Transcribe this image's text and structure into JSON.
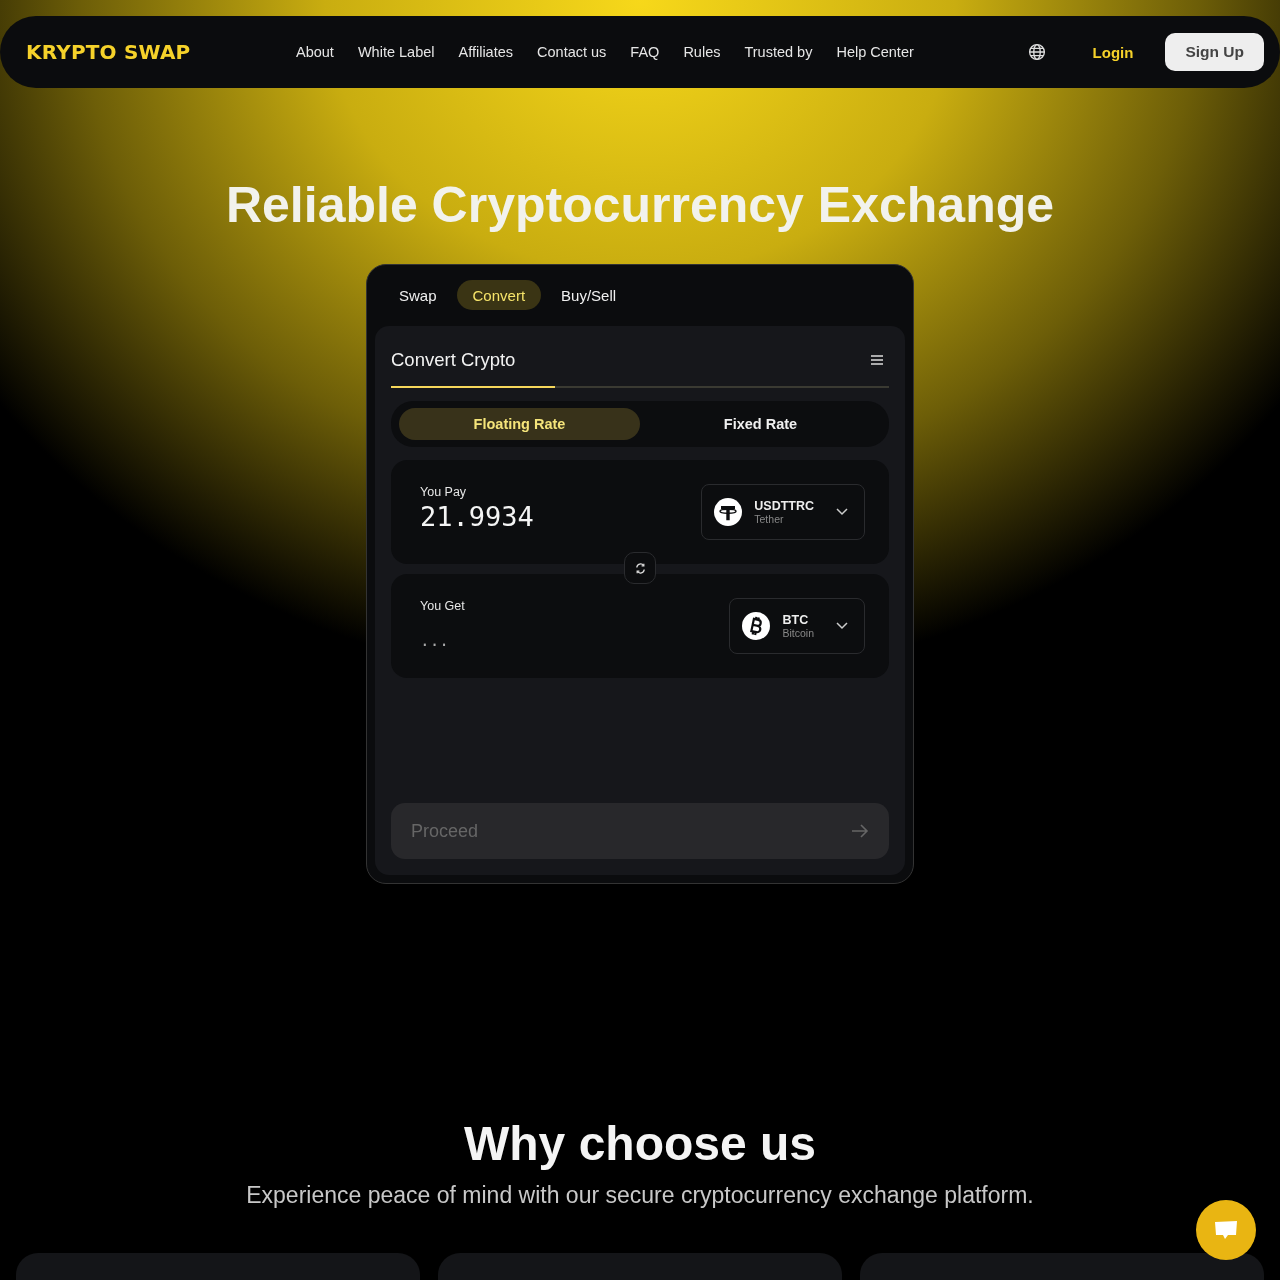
{
  "logo": "KRYPTO SWAP",
  "nav": [
    "About",
    "White Label",
    "Affiliates",
    "Contact us",
    "FAQ",
    "Rules",
    "Trusted by",
    "Help Center"
  ],
  "login": "Login",
  "signup": "Sign Up",
  "hero_title": "Reliable Cryptocurrency Exchange",
  "widget_tabs": [
    {
      "label": "Swap",
      "selected": false
    },
    {
      "label": "Convert",
      "selected": true
    },
    {
      "label": "Buy/Sell",
      "selected": false
    }
  ],
  "panel_title": "Convert Crypto",
  "rate_tabs": [
    {
      "label": "Floating Rate",
      "selected": true
    },
    {
      "label": "Fixed Rate",
      "selected": false
    }
  ],
  "pay": {
    "label": "You Pay",
    "value": "21.9934",
    "symbol": "USDTTRC",
    "name": "Tether",
    "kind": "tether"
  },
  "get": {
    "label": "You Get",
    "value": "...",
    "symbol": "BTC",
    "name": "Bitcoin",
    "kind": "bitcoin"
  },
  "proceed": {
    "label": "Proceed",
    "disabled": true
  },
  "why_title": "Why choose us",
  "why_subtitle": "Experience peace of mind with our secure cryptocurrency exchange platform.",
  "feature_cards": [
    {
      "kind": "card"
    },
    {
      "kind": "card"
    },
    {
      "kind": "card"
    }
  ]
}
